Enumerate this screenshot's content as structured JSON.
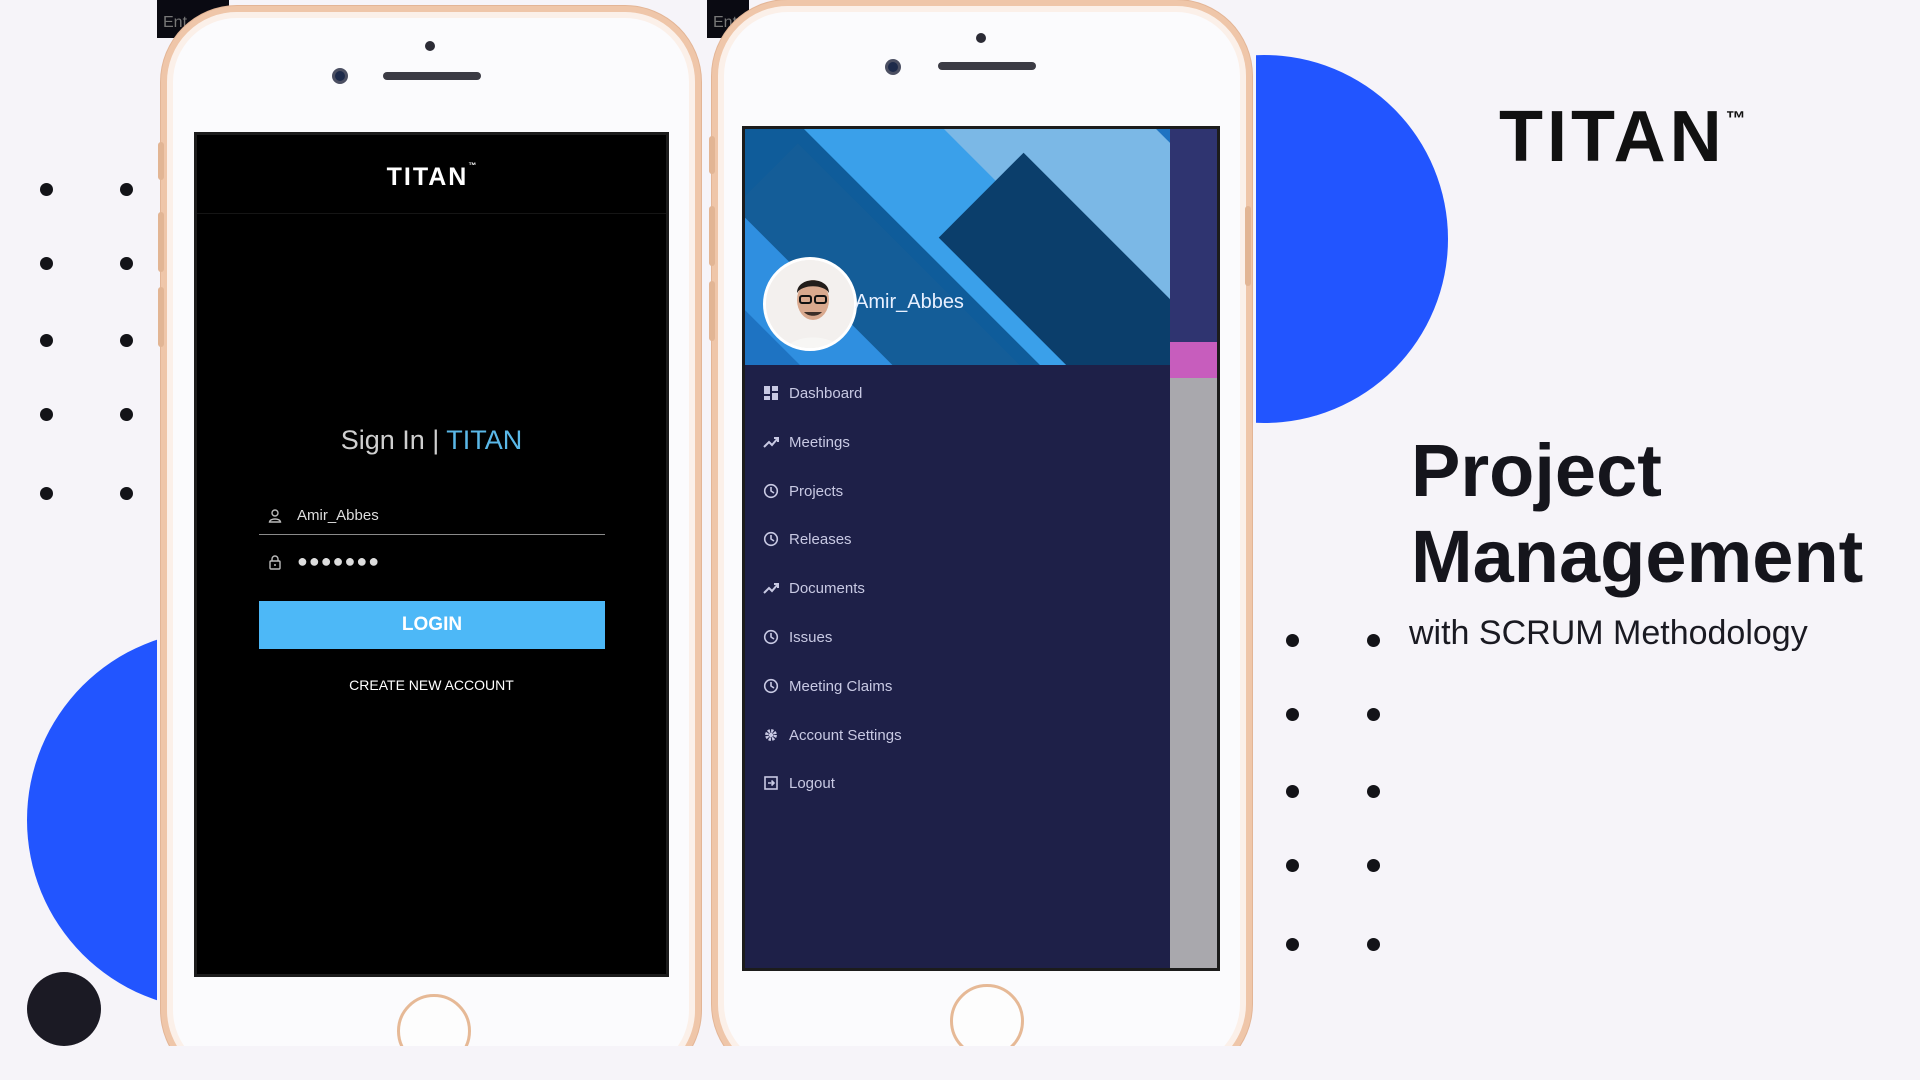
{
  "slide": {
    "logo": "TITAN",
    "logo_tm": "™",
    "headline_line1": "Project",
    "headline_line2": "Management",
    "subline": "with SCRUM Methodology",
    "accent_color": "#2255ff"
  },
  "login_screen": {
    "brand": "TITAN",
    "brand_tm": "™",
    "signin_prefix": "Sign In | ",
    "signin_accent": "TITAN",
    "username": "Amir_Abbes",
    "password_mask": "●●●●●●●",
    "login_label": "LOGIN",
    "create_account_label": "CREATE NEW ACCOUNT",
    "button_color": "#4db8f7"
  },
  "menu_screen": {
    "user_name": "Amir_Abbes",
    "items": [
      {
        "label": "Dashboard",
        "icon": "dashboard-icon"
      },
      {
        "label": "Meetings",
        "icon": "trending-icon"
      },
      {
        "label": "Projects",
        "icon": "clock-icon"
      },
      {
        "label": "Releases",
        "icon": "clock-icon"
      },
      {
        "label": "Documents",
        "icon": "trending-icon"
      },
      {
        "label": "Issues",
        "icon": "clock-icon"
      },
      {
        "label": "Meeting Claims",
        "icon": "clock-icon"
      },
      {
        "label": "Account Settings",
        "icon": "gear-icon"
      },
      {
        "label": "Logout",
        "icon": "logout-icon"
      }
    ],
    "background_color": "#1e2048"
  },
  "strips": {
    "left": "Ent",
    "right": "Ent"
  }
}
